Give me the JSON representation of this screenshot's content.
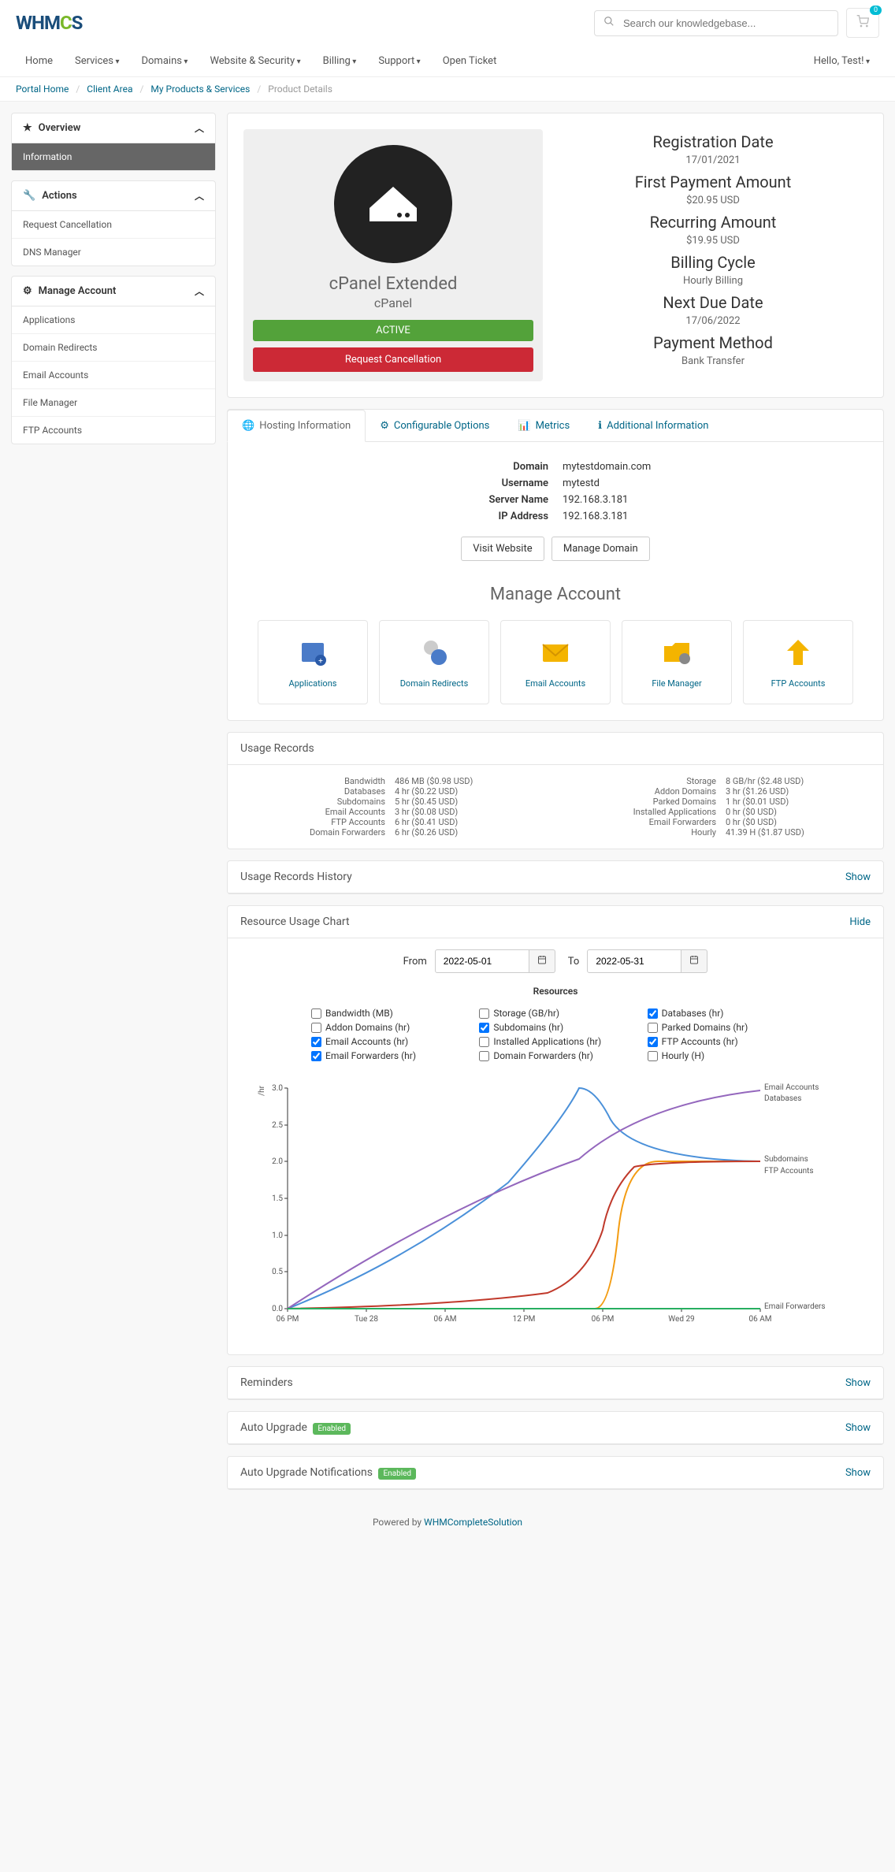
{
  "header": {
    "search_placeholder": "Search our knowledgebase...",
    "cart_count": "0"
  },
  "nav": {
    "items": [
      "Home",
      "Services",
      "Domains",
      "Website & Security",
      "Billing",
      "Support",
      "Open Ticket"
    ],
    "hello": "Hello, Test!"
  },
  "breadcrumb": {
    "portal": "Portal Home",
    "client": "Client Area",
    "products": "My Products & Services",
    "current": "Product Details"
  },
  "sidebar": {
    "overview": {
      "title": "Overview",
      "items": [
        "Information"
      ]
    },
    "actions": {
      "title": "Actions",
      "items": [
        "Request Cancellation",
        "DNS Manager"
      ]
    },
    "manage": {
      "title": "Manage Account",
      "items": [
        "Applications",
        "Domain Redirects",
        "Email Accounts",
        "File Manager",
        "FTP Accounts"
      ]
    }
  },
  "product": {
    "name": "cPanel Extended",
    "sub": "cPanel",
    "status": "ACTIVE",
    "cancel_btn": "Request Cancellation",
    "details": [
      {
        "label": "Registration Date",
        "value": "17/01/2021"
      },
      {
        "label": "First Payment Amount",
        "value": "$20.95 USD"
      },
      {
        "label": "Recurring Amount",
        "value": "$19.95 USD"
      },
      {
        "label": "Billing Cycle",
        "value": "Hourly Billing"
      },
      {
        "label": "Next Due Date",
        "value": "17/06/2022"
      },
      {
        "label": "Payment Method",
        "value": "Bank Transfer"
      }
    ]
  },
  "tabs": {
    "items": [
      "Hosting Information",
      "Configurable Options",
      "Metrics",
      "Additional Information"
    ],
    "hosting": {
      "rows": [
        {
          "k": "Domain",
          "v": "mytestdomain.com"
        },
        {
          "k": "Username",
          "v": "mytestd"
        },
        {
          "k": "Server Name",
          "v": "192.168.3.181"
        },
        {
          "k": "IP Address",
          "v": "192.168.3.181"
        }
      ],
      "visit_btn": "Visit Website",
      "manage_btn": "Manage Domain"
    },
    "manage_title": "Manage Account",
    "account_cards": [
      "Applications",
      "Domain Redirects",
      "Email Accounts",
      "File Manager",
      "FTP Accounts"
    ]
  },
  "usage": {
    "title": "Usage Records",
    "left": [
      {
        "k": "Bandwidth",
        "v": "486 MB ($0.98 USD)"
      },
      {
        "k": "Databases",
        "v": "4 hr ($0.22 USD)"
      },
      {
        "k": "Subdomains",
        "v": "5 hr ($0.45 USD)"
      },
      {
        "k": "Email Accounts",
        "v": "3 hr ($0.08 USD)"
      },
      {
        "k": "FTP Accounts",
        "v": "6 hr ($0.41 USD)"
      },
      {
        "k": "Domain Forwarders",
        "v": "6 hr ($0.26 USD)"
      }
    ],
    "right": [
      {
        "k": "Storage",
        "v": "8 GB/hr ($2.48 USD)"
      },
      {
        "k": "Addon Domains",
        "v": "3 hr ($1.26 USD)"
      },
      {
        "k": "Parked Domains",
        "v": "1 hr ($0.01 USD)"
      },
      {
        "k": "Installed Applications",
        "v": "0 hr ($0 USD)"
      },
      {
        "k": "Email Forwarders",
        "v": "0 hr ($0 USD)"
      },
      {
        "k": "Hourly",
        "v": "41.39 H ($1.87 USD)"
      }
    ]
  },
  "history": {
    "title": "Usage Records History",
    "toggle": "Show"
  },
  "chart_panel": {
    "title": "Resource Usage Chart",
    "toggle": "Hide",
    "from_label": "From",
    "to_label": "To",
    "from_value": "2022-05-01",
    "to_value": "2022-05-31",
    "chart_title": "Resources",
    "legend": [
      {
        "label": "Bandwidth (MB)",
        "checked": false
      },
      {
        "label": "Storage (GB/hr)",
        "checked": false
      },
      {
        "label": "Databases (hr)",
        "checked": true
      },
      {
        "label": "Addon Domains (hr)",
        "checked": false
      },
      {
        "label": "Subdomains (hr)",
        "checked": true
      },
      {
        "label": "Parked Domains (hr)",
        "checked": false
      },
      {
        "label": "Email Accounts (hr)",
        "checked": true
      },
      {
        "label": "Installed Applications (hr)",
        "checked": false
      },
      {
        "label": "FTP Accounts (hr)",
        "checked": true
      },
      {
        "label": "Email Forwarders (hr)",
        "checked": true
      },
      {
        "label": "Domain Forwarders (hr)",
        "checked": false
      },
      {
        "label": "Hourly (H)",
        "checked": false
      }
    ]
  },
  "chart_data": {
    "type": "line",
    "xlabel": "",
    "ylabel": "/hr",
    "ylim": [
      0,
      3.0
    ],
    "x_ticks": [
      "06 PM",
      "Tue 28",
      "06 AM",
      "12 PM",
      "06 PM",
      "Wed 29",
      "06 AM"
    ],
    "series": [
      {
        "name": "Email Accounts",
        "color": "#4a90d9",
        "end_value": 3.0
      },
      {
        "name": "Databases",
        "color": "#9467bd",
        "end_value": 3.0
      },
      {
        "name": "Subdomains",
        "color": "#f39c12",
        "end_value": 2.0
      },
      {
        "name": "FTP Accounts",
        "color": "#c0392b",
        "end_value": 2.0
      },
      {
        "name": "Email Forwarders",
        "color": "#27ae60",
        "end_value": 0.0
      }
    ]
  },
  "reminders": {
    "title": "Reminders",
    "toggle": "Show"
  },
  "auto_upgrade": {
    "title": "Auto Upgrade",
    "badge": "Enabled",
    "toggle": "Show"
  },
  "auto_upgrade_notif": {
    "title": "Auto Upgrade Notifications",
    "badge": "Enabled",
    "toggle": "Show"
  },
  "footer": {
    "powered": "Powered by ",
    "link": "WHMCompleteSolution"
  }
}
